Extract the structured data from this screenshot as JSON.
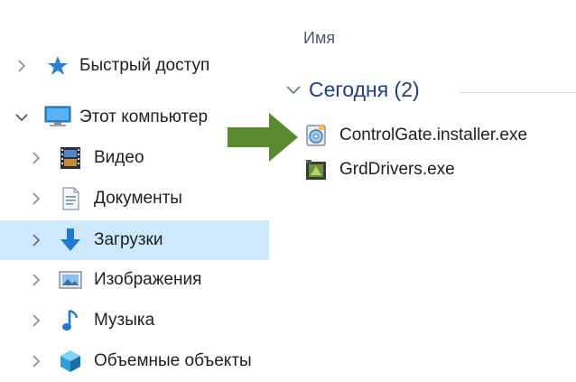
{
  "nav": {
    "items": [
      {
        "label": "Быстрый доступ",
        "icon": "star-icon"
      },
      {
        "label": "Этот компьютер",
        "icon": "computer-icon"
      },
      {
        "label": "Видео",
        "icon": "video-icon"
      },
      {
        "label": "Документы",
        "icon": "documents-icon"
      },
      {
        "label": "Загрузки",
        "icon": "downloads-icon"
      },
      {
        "label": "Изображения",
        "icon": "pictures-icon"
      },
      {
        "label": "Музыка",
        "icon": "music-icon"
      },
      {
        "label": "Объемные объекты",
        "icon": "3d-objects-icon"
      }
    ],
    "selected": "Загрузки"
  },
  "content": {
    "column_header": "Имя",
    "group": {
      "title": "Сегодня (2)",
      "expanded": true
    },
    "files": [
      {
        "name": "ControlGate.installer.exe",
        "icon": "installer-icon"
      },
      {
        "name": "GrdDrivers.exe",
        "icon": "driver-exe-icon"
      }
    ]
  },
  "colors": {
    "selection": "#cde8ff",
    "group_title": "#1e3d8a",
    "annotation_arrow": "#5a8a2e"
  }
}
